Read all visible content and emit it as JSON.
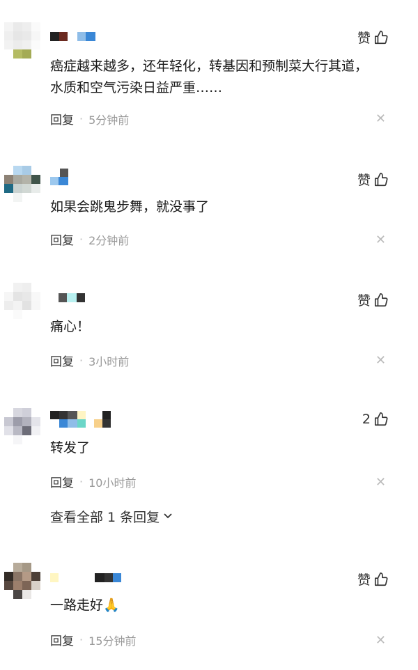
{
  "comments": [
    {
      "text": "癌症越来越多，还年轻化，转基因和预制菜大行其道，水质和空气污染日益严重……",
      "reply_label": "回复",
      "time": "5分钟前",
      "likes": "赞"
    },
    {
      "text": "如果会跳鬼步舞，就没事了",
      "reply_label": "回复",
      "time": "2分钟前",
      "likes": "赞"
    },
    {
      "text": "痛心！",
      "reply_label": "回复",
      "time": "3小时前",
      "likes": "赞"
    },
    {
      "text": "转发了",
      "reply_label": "回复",
      "time": "10小时前",
      "likes": "2"
    },
    {
      "text": "一路走好🙏",
      "reply_label": "回复",
      "time": "15分钟前",
      "likes": "赞"
    }
  ],
  "view_all_replies": "查看全部 1 条回复",
  "icons": {
    "like": "thumbs-up-icon",
    "close": "close-icon",
    "expand": "chevron-down-icon"
  },
  "colors": {
    "text": "#1a1a1a",
    "meta": "#999999",
    "icon": "#333333"
  }
}
